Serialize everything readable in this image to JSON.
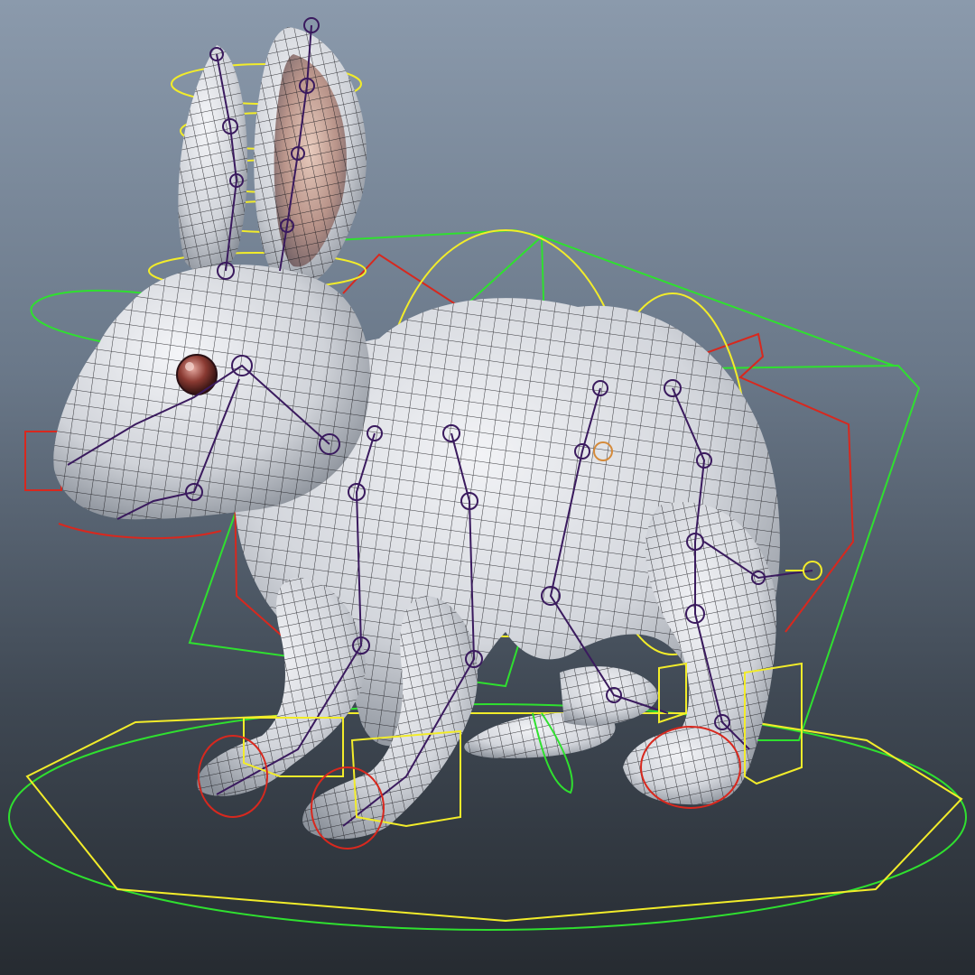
{
  "viewport": {
    "background_top": "#8b9aac",
    "background_bottom": "#262b31"
  },
  "scene": {
    "subject": "rabbit",
    "colors": {
      "mesh_fill": "#e4e6ea",
      "mesh_shadow": "#8c929b",
      "wireframe": "#1a1a1e",
      "joint": "#3a1a5e",
      "control_yellow": "#f2ec2a",
      "control_green": "#2fe02f",
      "control_red": "#d8281e",
      "eye": "#8a3a32",
      "ear_inner": "#c79a86"
    }
  }
}
